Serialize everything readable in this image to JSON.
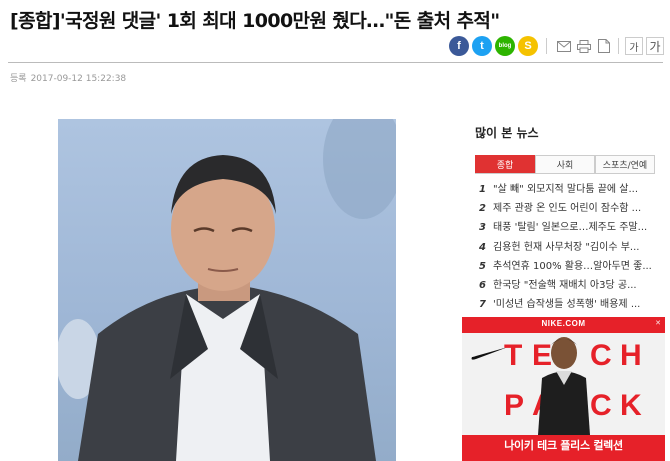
{
  "article": {
    "headline": "[종합]'국정원 댓글' 1회 최대 1000만원 줬다…\"돈 출처 추적\"",
    "date_label": "등록",
    "date_value": "2017-09-12 15:22:38"
  },
  "share": {
    "facebook": "f",
    "twitter": "t",
    "blog": "blog",
    "story": "S",
    "font_small": "가",
    "font_large": "가"
  },
  "popular": {
    "title": "많이 본 뉴스",
    "tabs": [
      "종합",
      "사회",
      "스포츠/연예"
    ],
    "items": [
      {
        "num": "1",
        "text": "\"살 빼\" 외모지적 말다툼 끝에 살..."
      },
      {
        "num": "2",
        "text": "제주 관광 온 인도 어린이 잠수함 ..."
      },
      {
        "num": "3",
        "text": "태풍 '탈림' 일본으로…제주도 주말..."
      },
      {
        "num": "4",
        "text": "김용헌 헌재 사무처장 \"김이수 부..."
      },
      {
        "num": "5",
        "text": "추석연휴 100% 활용…알아두면 좋..."
      },
      {
        "num": "6",
        "text": "한국당 \"전술핵 재배치 아3당 공..."
      },
      {
        "num": "7",
        "text": "'미성년 습작생들 성폭행' 배용제 ..."
      }
    ]
  },
  "ad": {
    "brand": "NIKE.COM",
    "letters": [
      "T",
      "E",
      "C",
      "H",
      "P",
      "A",
      "C",
      "K"
    ],
    "caption": "나이키 테크 플리스 컬렉션"
  },
  "colors": {
    "accent": "#e03232",
    "facebook": "#3b5998",
    "twitter": "#1da1f2",
    "blog": "#2db400",
    "story": "#f5c200",
    "ad_red": "#e62129"
  }
}
